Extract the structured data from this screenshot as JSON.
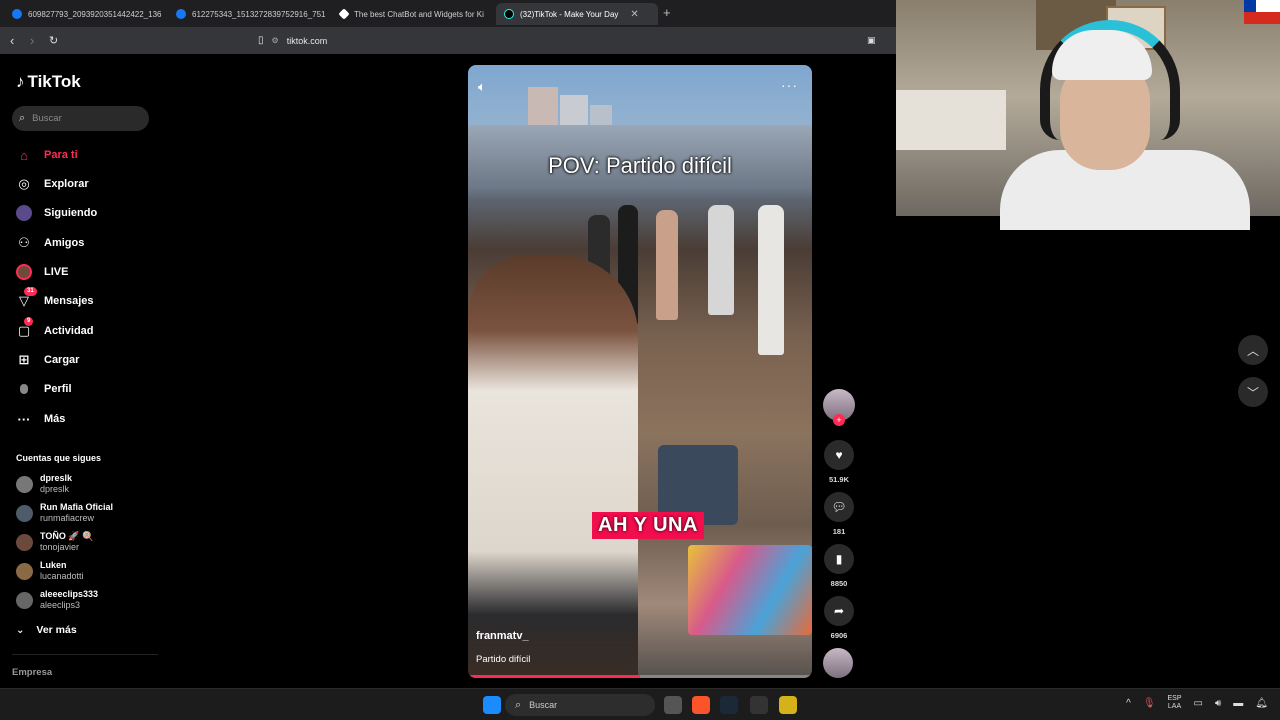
{
  "browser": {
    "tabs": [
      {
        "title": "609827793_2093920351442422_136"
      },
      {
        "title": "612275343_1513272839752916_751"
      },
      {
        "title": "The best ChatBot and Widgets for Ki"
      },
      {
        "title": "(32)TikTok - Make Your Day"
      }
    ],
    "url": "tiktok.com"
  },
  "sidebar": {
    "logo": "TikTok",
    "search_placeholder": "Buscar",
    "nav": [
      {
        "label": "Para ti",
        "icon": "home-icon"
      },
      {
        "label": "Explorar",
        "icon": "compass-icon"
      },
      {
        "label": "Siguiendo",
        "icon": "following-icon"
      },
      {
        "label": "Amigos",
        "icon": "friends-icon"
      },
      {
        "label": "LIVE",
        "icon": "live-icon"
      },
      {
        "label": "Mensajes",
        "icon": "messages-icon",
        "badge": "31"
      },
      {
        "label": "Actividad",
        "icon": "activity-icon",
        "badge": "9"
      },
      {
        "label": "Cargar",
        "icon": "upload-icon"
      },
      {
        "label": "Perfil",
        "icon": "profile-icon"
      },
      {
        "label": "Más",
        "icon": "more-icon"
      }
    ],
    "following_title": "Cuentas que sigues",
    "accounts": [
      {
        "name": "dpreslk",
        "handle": "dpreslk"
      },
      {
        "name": "Run Mafia Oficial",
        "handle": "runmafiacrew"
      },
      {
        "name": "TOÑO 🚀 🍭",
        "handle": "tonojavier"
      },
      {
        "name": "Luken",
        "handle": "lucanadotti"
      },
      {
        "name": "aleeeclips333",
        "handle": "aleeclips3"
      }
    ],
    "see_more": "Ver más",
    "footer": "Empresa"
  },
  "video": {
    "overlay_title": "POV: Partido difícil",
    "caption": "AH Y UNA",
    "author": "franmatv_",
    "description": "Partido difícil",
    "progress": 0.5
  },
  "actions": {
    "likes": "51.9K",
    "comments": "181",
    "saves": "8850",
    "shares": "6906"
  },
  "taskbar": {
    "search": "Buscar",
    "lang_top": "ESP",
    "lang_bottom": "LAA"
  },
  "colors": {
    "accent": "#fe2c55",
    "background": "#000000"
  }
}
